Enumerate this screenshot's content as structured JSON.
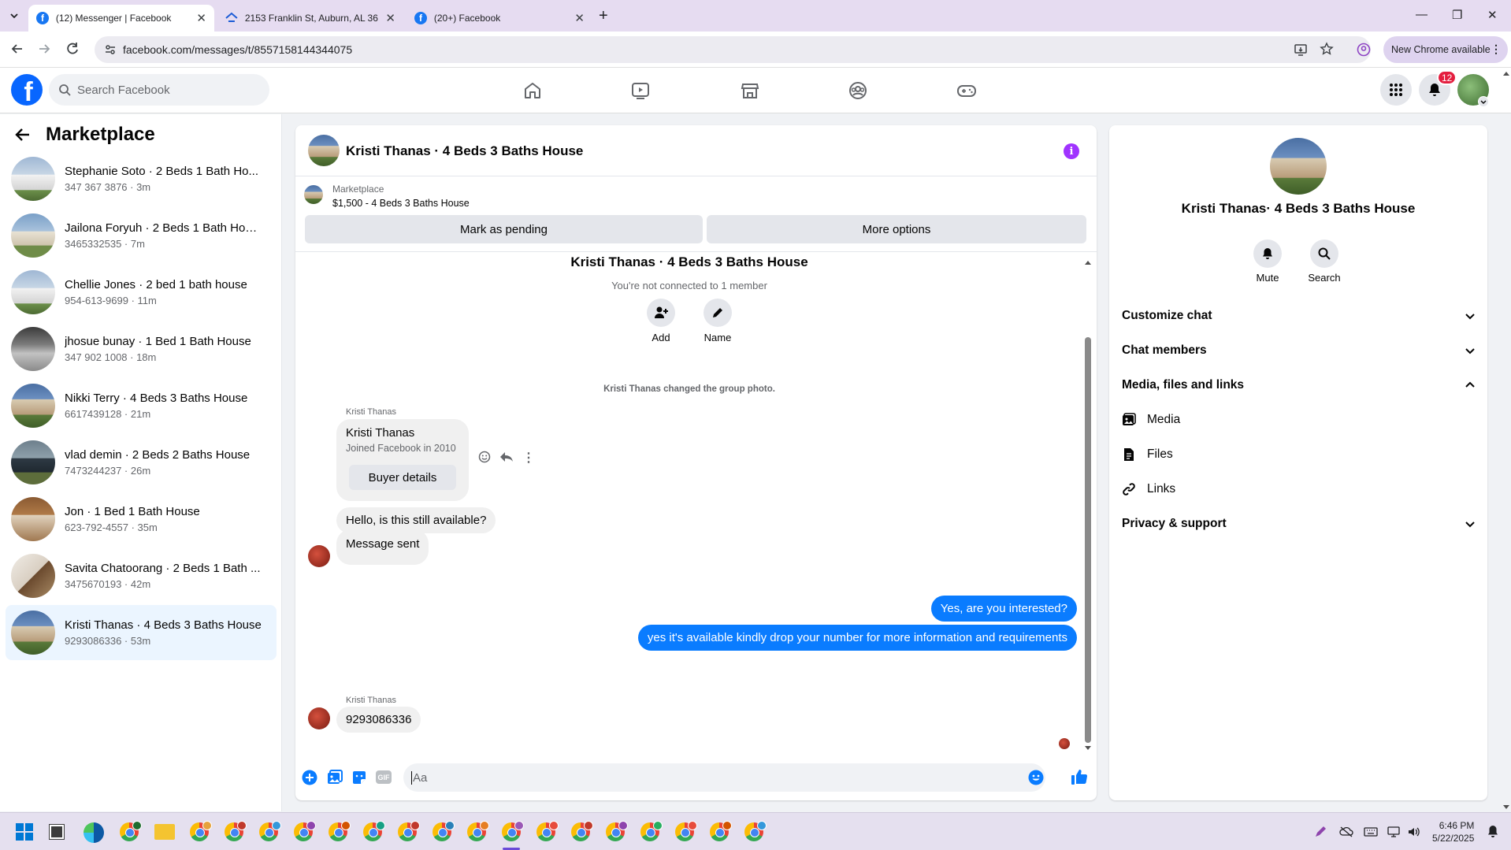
{
  "browser": {
    "tabs": [
      {
        "title": "(12) Messenger | Facebook",
        "active": true
      },
      {
        "title": "2153 Franklin St, Auburn, AL 36",
        "active": false
      },
      {
        "title": "(20+) Facebook",
        "active": false
      }
    ],
    "url": "facebook.com/messages/t/8557158144344075",
    "new_chrome_label": "New Chrome available"
  },
  "fb": {
    "search_placeholder": "Search Facebook",
    "notification_count": "12"
  },
  "sidebar": {
    "title": "Marketplace",
    "conversations": [
      {
        "name": "Stephanie Soto · 2 Beds 1 Bath Ho...",
        "sub": "347 367 3876 · 3m",
        "selected": false
      },
      {
        "name": "Jailona Foryuh · 2 Beds 1 Bath Hou...",
        "sub": "3465332535 · 7m",
        "selected": false
      },
      {
        "name": "Chellie Jones · 2 bed 1 bath house",
        "sub": "954-613-9699 · 11m",
        "selected": false
      },
      {
        "name": "jhosue bunay · 1 Bed 1 Bath House",
        "sub": "347 902 1008 · 18m",
        "selected": false
      },
      {
        "name": "Nikki Terry · 4 Beds 3 Baths House",
        "sub": "6617439128 · 21m",
        "selected": false
      },
      {
        "name": "vlad demin · 2 Beds 2 Baths House",
        "sub": "7473244237 · 26m",
        "selected": false
      },
      {
        "name": "Jon · 1 Bed 1 Bath House",
        "sub": "623-792-4557 · 35m",
        "selected": false
      },
      {
        "name": "Savita Chatoorang · 2 Beds 1 Bath ...",
        "sub": "3475670193 · 42m",
        "selected": false
      },
      {
        "name": "Kristi Thanas · 4 Beds 3 Baths House",
        "sub": "9293086336 · 53m",
        "selected": true
      }
    ]
  },
  "chat": {
    "header_name": "Kristi Thanas · 4 Beds 3 Baths House",
    "listing_label": "Marketplace",
    "listing_detail": "$1,500 - 4 Beds 3 Baths House",
    "mark_pending_label": "Mark as pending",
    "more_options_label": "More options",
    "group_title": "Kristi Thanas · 4 Beds 3 Baths House",
    "not_connected": "You're not connected to 1 member",
    "add_label": "Add",
    "name_label": "Name",
    "system_msg": "Kristi Thanas changed the group photo.",
    "sender1": "Kristi Thanas",
    "card_name": "Kristi Thanas",
    "card_sub": "Joined Facebook in 2010",
    "buyer_details_label": "Buyer details",
    "msg1": "Hello, is this still available?",
    "msg2": "Message sent",
    "my_msg1": "Yes, are you interested?",
    "my_msg2": "yes it's available kindly drop your number for more information and requirements",
    "sender2": "Kristi Thanas",
    "msg3": "9293086336",
    "composer_placeholder": "Aa",
    "colors": {
      "accent": "#0a7cff",
      "info": "#a033ff"
    }
  },
  "info_panel": {
    "name": "Kristi Thanas· 4 Beds 3 Baths House",
    "mute_label": "Mute",
    "search_label": "Search",
    "sections": {
      "customize": "Customize chat",
      "members": "Chat members",
      "media_files_links": "Media, files and links",
      "media": "Media",
      "files": "Files",
      "links": "Links",
      "privacy": "Privacy & support"
    }
  },
  "taskbar": {
    "time": "6:46 PM",
    "date": "5/22/2025"
  }
}
